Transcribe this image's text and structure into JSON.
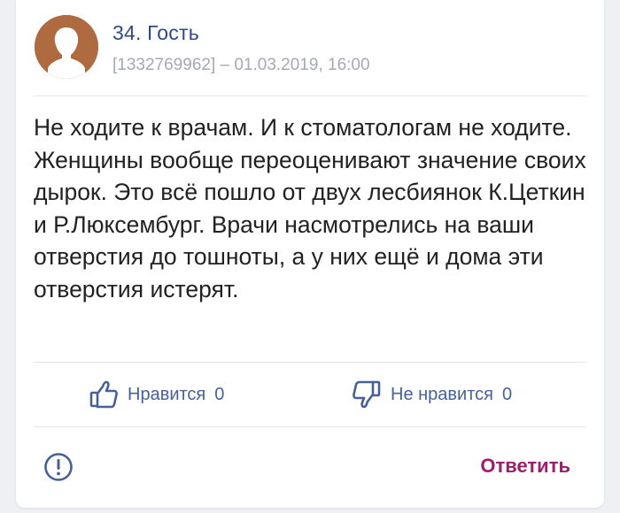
{
  "post": {
    "author": "34. Гость",
    "meta": "[1332769962] – 01.03.2019, 16:00",
    "text": "Не ходите к врачам. И к стоматологам не ходите. Женщины вообще переоценивают значение своих дырок. Это всё пошло от двух лесбиянок К.Цеткин и Р.Люксембург. Врачи насмотрелись на ваши отверстия до тошноты, а у них ещё и дома эти отверстия истерят."
  },
  "actions": {
    "like_label": "Нравится",
    "like_count": "0",
    "dislike_label": "Не нравится",
    "dislike_count": "0",
    "reply_label": "Ответить"
  },
  "icons": {
    "avatar": "person-silhouette-icon",
    "like": "thumbs-up-icon",
    "dislike": "thumbs-down-icon",
    "report": "exclamation-circle-icon"
  },
  "colors": {
    "accent": "#46609a",
    "reply": "#9b1f6c",
    "avatar_bg": "#b06a40"
  }
}
